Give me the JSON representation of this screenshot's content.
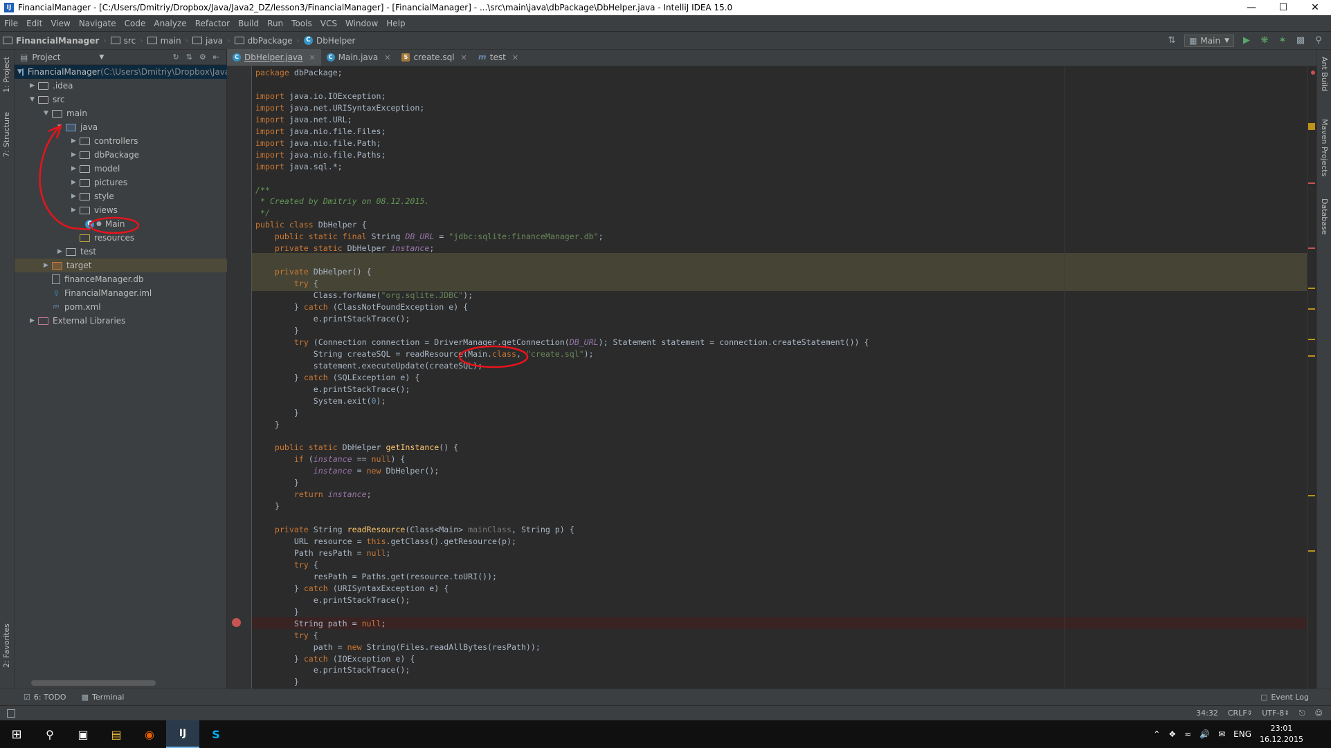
{
  "window": {
    "title": "FinancialManager - [C:/Users/Dmitriy/Dropbox/Java/Java2_DZ/lesson3/FinancialManager] - [FinancialManager] - ...\\src\\main\\java\\dbPackage\\DbHelper.java - IntelliJ IDEA 15.0",
    "icon_label": "IJ"
  },
  "menu": [
    "File",
    "Edit",
    "View",
    "Navigate",
    "Code",
    "Analyze",
    "Refactor",
    "Build",
    "Run",
    "Tools",
    "VCS",
    "Window",
    "Help"
  ],
  "breadcrumbs": [
    "FinancialManager",
    "src",
    "main",
    "java",
    "dbPackage",
    "DbHelper"
  ],
  "run_config": "Main",
  "left_tabs": {
    "project": "1: Project",
    "structure": "7: Structure",
    "favorites": "2: Favorites"
  },
  "right_tabs": {
    "ant": "Ant Build",
    "maven": "Maven Projects",
    "database": "Database"
  },
  "project_panel": {
    "title": "Project",
    "tree": [
      {
        "label": "FinancialManager",
        "extra": " (C:\\Users\\Dmitriy\\Dropbox\\Java"
      },
      {
        "label": ".idea"
      },
      {
        "label": "src"
      },
      {
        "label": "main"
      },
      {
        "label": "java"
      },
      {
        "label": "controllers"
      },
      {
        "label": "dbPackage"
      },
      {
        "label": "model"
      },
      {
        "label": "pictures"
      },
      {
        "label": "style"
      },
      {
        "label": "views"
      },
      {
        "label": "Main"
      },
      {
        "label": "resources"
      },
      {
        "label": "test"
      },
      {
        "label": "target"
      },
      {
        "label": "financeManager.db"
      },
      {
        "label": "FinancialManager.iml"
      },
      {
        "label": "pom.xml"
      },
      {
        "label": "External Libraries"
      }
    ]
  },
  "editor_tabs": [
    {
      "label": "DbHelper.java",
      "icon": "C",
      "color": "#3592c4"
    },
    {
      "label": "Main.java",
      "icon": "C",
      "color": "#3592c4"
    },
    {
      "label": "create.sql",
      "icon": "S",
      "color": "#a17a3c"
    },
    {
      "label": "test",
      "icon": "m",
      "color": "#6a8ab5"
    }
  ],
  "code_lines": [
    "package dbPackage;",
    "",
    "import java.io.IOException;",
    "import java.net.URISyntaxException;",
    "import java.net.URL;",
    "import java.nio.file.Files;",
    "import java.nio.file.Path;",
    "import java.nio.file.Paths;",
    "import java.sql.*;",
    "",
    "/**",
    " * Created by Dmitriy on 08.12.2015.",
    " */",
    "public class DbHelper {",
    "    public static final String DB_URL = \"jdbc:sqlite:financeManager.db\";",
    "    private static DbHelper instance;",
    "",
    "    private DbHelper() {",
    "        try {",
    "            Class.forName(\"org.sqlite.JDBC\");",
    "        } catch (ClassNotFoundException e) {",
    "            e.printStackTrace();",
    "        }",
    "        try (Connection connection = DriverManager.getConnection(DB_URL); Statement statement = connection.createStatement()) {",
    "            String createSQL = readResource(Main.class, \"create.sql\");",
    "            statement.executeUpdate(createSQL);",
    "        } catch (SQLException e) {",
    "            e.printStackTrace();",
    "            System.exit(0);",
    "        }",
    "    }",
    "",
    "    public static DbHelper getInstance() {",
    "        if (instance == null) {",
    "            instance = new DbHelper();",
    "        }",
    "        return instance;",
    "    }",
    "",
    "    private String readResource(Class<Main> mainClass, String p) {",
    "        URL resource = this.getClass().getResource(p);",
    "        Path resPath = null;",
    "        try {",
    "            resPath = Paths.get(resource.toURI());",
    "        } catch (URISyntaxException e) {",
    "            e.printStackTrace();",
    "        }",
    "        String path = null;",
    "        try {",
    "            path = new String(Files.readAllBytes(resPath));",
    "        } catch (IOException e) {",
    "            e.printStackTrace();",
    "        }"
  ],
  "bottom_tabs": {
    "todo": "6: TODO",
    "terminal": "Terminal",
    "event_log": "Event Log"
  },
  "status": {
    "position": "34:32",
    "line_sep": "CRLF",
    "encoding": "UTF-8"
  },
  "tray": {
    "lang": "ENG",
    "time": "23:01",
    "date": "16.12.2015"
  },
  "colors": {
    "accent": "#3592c4",
    "annotation": "#e8141c",
    "breakpoint": "#c75450"
  }
}
